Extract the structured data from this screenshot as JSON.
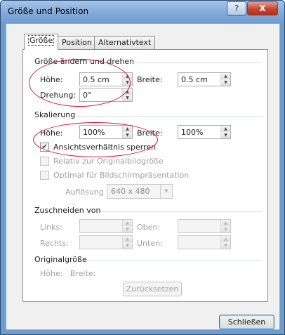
{
  "window": {
    "title": "Größe und Position",
    "help_glyph": "?",
    "close_glyph": "X"
  },
  "tabs": [
    {
      "label": "Größe",
      "active": true
    },
    {
      "label": "Position",
      "active": false
    },
    {
      "label": "Alternativtext",
      "active": false
    }
  ],
  "size_section": {
    "header": "Größe ändern und drehen",
    "height_label": "Höhe:",
    "height_value": "0.5 cm",
    "width_label": "Breite:",
    "width_value": "0.5 cm",
    "rotation_label": "Drehung:",
    "rotation_value": "0°"
  },
  "scale_section": {
    "header": "Skalierung",
    "height_label": "Höhe:",
    "height_value": "100%",
    "width_label": "Breite:",
    "width_value": "100%",
    "lock_aspect_label": "Ansichtsverhältnis sperren",
    "lock_aspect_checked": true,
    "relative_label": "Relativ zur Originalbildgröße",
    "optimal_label": "Optimal für Bildschirmpräsentation",
    "resolution_label": "Auflösung",
    "resolution_value": "640 x 480"
  },
  "crop_section": {
    "header": "Zuschneiden von",
    "left_label": "Links:",
    "top_label": "Oben:",
    "right_label": "Rechts:",
    "bottom_label": "Unten:"
  },
  "original_section": {
    "header": "Originalgröße",
    "info": "Höhe:   Breite:",
    "reset_label": "Zurücksetzen"
  },
  "footer": {
    "close_label": "Schließen"
  },
  "colors": {
    "annotation": "#d6172a",
    "title_bar": "#7ea8d8",
    "close_button": "#c6452f"
  },
  "icons": [
    "help-icon",
    "close-icon",
    "spin-up-icon",
    "spin-down-icon",
    "checkmark-icon",
    "dropdown-arrow-icon"
  ]
}
